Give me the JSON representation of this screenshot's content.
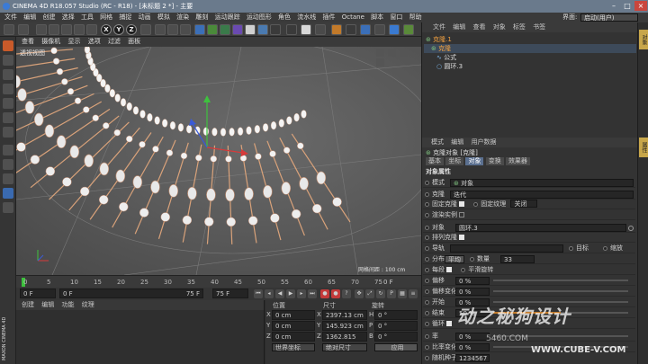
{
  "window": {
    "title": "CINEMA 4D R18.057 Studio (RC - R18) - [未标题 2 *] - 主要"
  },
  "menu": [
    "文件",
    "编辑",
    "创建",
    "选择",
    "工具",
    "网格",
    "捕捉",
    "动画",
    "模拟",
    "渲染",
    "雕刻",
    "运动跟踪",
    "运动图形",
    "角色",
    "流水线",
    "插件",
    "Octane",
    "脚本",
    "窗口",
    "帮助"
  ],
  "layout": {
    "label": "界面:",
    "value": "启动(用户)"
  },
  "viewport_menu": [
    "查看",
    "摄像机",
    "显示",
    "选项",
    "过滤",
    "面板"
  ],
  "viewport": {
    "title": "透视视图",
    "grid_info": "网格间距 : 100 cm"
  },
  "axis_buttons": [
    "X",
    "Y",
    "Z"
  ],
  "timeline": {
    "ticks": [
      "0",
      "5",
      "10",
      "15",
      "20",
      "25",
      "30",
      "35",
      "40",
      "45",
      "50",
      "55",
      "60",
      "65",
      "70",
      "75"
    ],
    "end_label": "0 F"
  },
  "transport": {
    "current": "0 F",
    "start": "0 F",
    "end": "75 F",
    "end2": "75 F"
  },
  "material_menu": [
    "创建",
    "编辑",
    "功能",
    "纹理"
  ],
  "coords": {
    "headers": [
      "位置",
      "尺寸",
      "旋转"
    ],
    "rows": [
      {
        "axis": "X",
        "pos": "0 cm",
        "size": "2397.13 cm",
        "rot_label": "H",
        "rot": "0 °"
      },
      {
        "axis": "Y",
        "pos": "0 cm",
        "size": "145.923 cm",
        "rot_label": "P",
        "rot": "0 °"
      },
      {
        "axis": "Z",
        "pos": "0 cm",
        "size": "1362.815 cm",
        "rot_label": "B",
        "rot": "0 °"
      }
    ],
    "mode1": "世界坐标",
    "mode2": "绝对尺寸",
    "apply": "应用"
  },
  "object_manager": {
    "menu": [
      "文件",
      "编辑",
      "查看",
      "对象",
      "标签",
      "书签"
    ],
    "objects": [
      {
        "name": "克隆.1",
        "indent": 0
      },
      {
        "name": "克隆",
        "indent": 1
      },
      {
        "name": "公式",
        "indent": 2
      },
      {
        "name": "圆环.3",
        "indent": 2
      }
    ]
  },
  "attributes": {
    "menu": [
      "模式",
      "编辑",
      "用户数据"
    ],
    "object_title": "克隆对象 [克隆]",
    "tabs": [
      "基本",
      "坐标",
      "对象",
      "变换",
      "效果器"
    ],
    "active_tab": "对象",
    "section": "对象属性",
    "mode_label": "模式",
    "mode_value": "对象",
    "clone_label": "克隆",
    "clone_value": "迭代",
    "fix_clone": "固定克隆",
    "fix_texture": "固定纹理",
    "fix_texture_value": "关闭",
    "render_instances": "渲染实例",
    "object_label": "对象",
    "object_value": "圆环.3",
    "arrange": "排列克隆",
    "guide": "导轨",
    "target": "目标",
    "scale": "缩放",
    "distribution_label": "分布",
    "distribution_value": "平均",
    "count_label": "数量",
    "count_value": "33",
    "each_segment": "每段",
    "smooth_rotation": "平滑旋转",
    "offset_label": "偏移",
    "offset_value": "0 %",
    "offset_var_label": "偏移变化",
    "offset_var_value": "0 %",
    "start_label": "开始",
    "start_value": "0 %",
    "end_label": "结束",
    "end_value": "50 %",
    "loop": "循环",
    "rate_label": "率",
    "rate_value": "0 %",
    "rate_var_label": "比率变化",
    "rate_var_value": "0 %",
    "seed_label": "随机种子",
    "seed_value": "1234567"
  },
  "right_tabs": [
    "对象",
    "属性"
  ],
  "watermark": {
    "cn": "动之秘狗设计",
    "url": "WWW.CUBE-V.COM",
    "mid": "5460.COM"
  },
  "maxon_label": "MAXON CINEMA 4D"
}
